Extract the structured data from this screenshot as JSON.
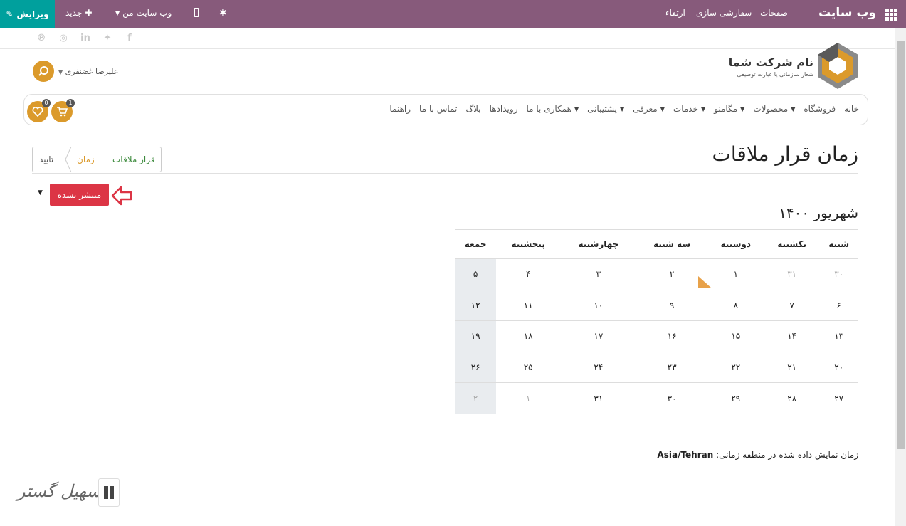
{
  "topbar": {
    "edit_label": "ویرایش",
    "new_label": "جدید",
    "my_site_label": "وب سایت من",
    "upgrade": "ارتقاء",
    "customize": "سفارشی سازی",
    "pages": "صفحات",
    "brand": "وب سایت"
  },
  "header": {
    "company_name": "نام شرکت شما",
    "company_slogan": "شعار سازمانی یا عبارت توصیفی",
    "user_name": "علیرضا غضنفری",
    "cart_count": "1",
    "wishlist_count": "0"
  },
  "nav": {
    "items": [
      "خانه",
      "فروشگاه",
      "محصولات",
      "مگامنو",
      "خدمات",
      "معرفی",
      "پشتیبانی",
      "همکاری با ما",
      "رویدادها",
      "بلاگ",
      "تماس با ما",
      "راهنما"
    ],
    "has_caret": [
      false,
      false,
      true,
      true,
      true,
      true,
      true,
      true,
      false,
      false,
      false,
      false
    ]
  },
  "breadcrumb": {
    "step1": "قرار ملاقات",
    "step2": "زمان",
    "step3": "تایید"
  },
  "page": {
    "title": "زمان قرار ملاقات",
    "unpublished_label": "منتشر نشده",
    "month": "شهریور ۱۴۰۰",
    "tz_label": "زمان نمایش داده شده در منطقه زمانی:",
    "tz_value": "Asia/Tehran"
  },
  "calendar": {
    "weekdays": [
      "شنبه",
      "یکشنبه",
      "دوشنبه",
      "سه شنبه",
      "چهارشنبه",
      "پنجشنبه",
      "جمعه"
    ],
    "weeks": [
      [
        "۳۰",
        "۳۱",
        "۱",
        "۲",
        "۳",
        "۴",
        "۵"
      ],
      [
        "۶",
        "۷",
        "۸",
        "۹",
        "۱۰",
        "۱۱",
        "۱۲"
      ],
      [
        "۱۳",
        "۱۴",
        "۱۵",
        "۱۶",
        "۱۷",
        "۱۸",
        "۱۹"
      ],
      [
        "۲۰",
        "۲۱",
        "۲۲",
        "۲۳",
        "۲۴",
        "۲۵",
        "۲۶"
      ],
      [
        "۲۷",
        "۲۸",
        "۲۹",
        "۳۰",
        "۳۱",
        "۱",
        "۲"
      ]
    ],
    "muted": [
      [
        0,
        0
      ],
      [
        0,
        1
      ],
      [
        4,
        5
      ],
      [
        4,
        6
      ]
    ]
  },
  "colors": {
    "topbar": "#875A7B",
    "edit_button": "#00A09D",
    "accent": "#DB9A2B",
    "unpublished": "#DC3545"
  },
  "icons": [
    "apps-grid-icon",
    "bug-icon",
    "mobile-icon",
    "plus-icon",
    "pencil-icon",
    "search-icon",
    "cart-icon",
    "heart-icon",
    "facebook-icon",
    "twitter-icon",
    "linkedin-icon",
    "instagram-icon",
    "pinterest-icon"
  ],
  "watermark": "تسهیل گستر"
}
